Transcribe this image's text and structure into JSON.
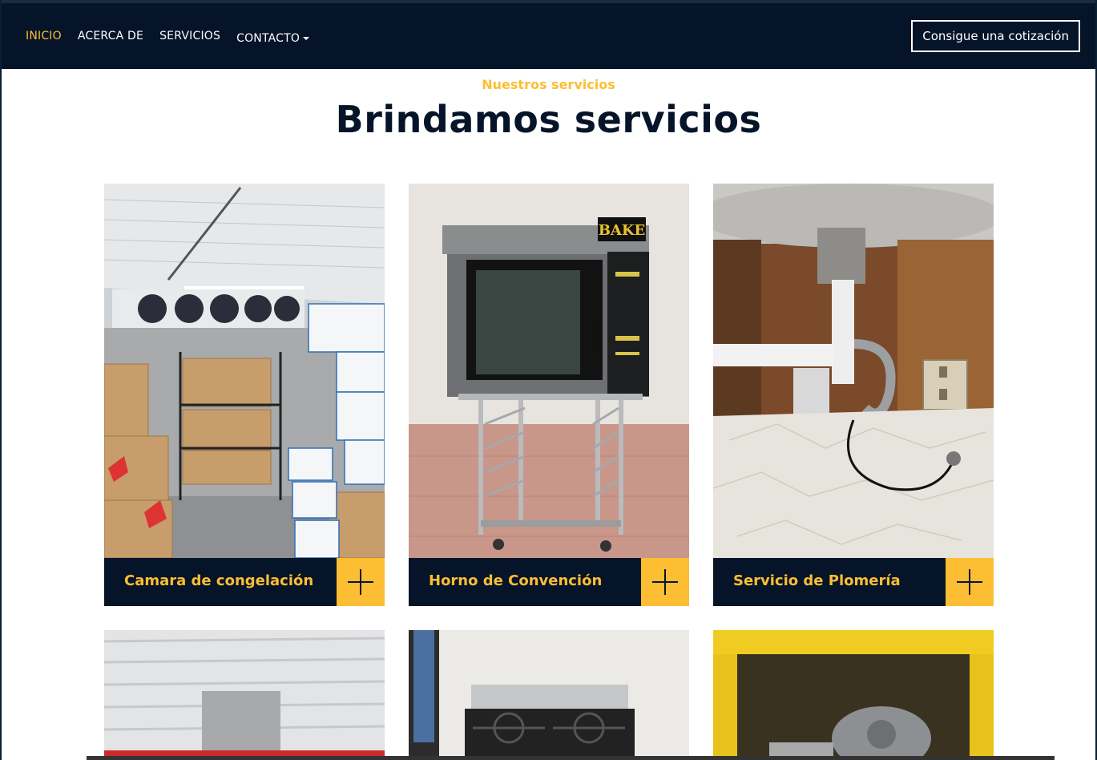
{
  "nav": {
    "links": [
      "INICIO",
      "ACERCA DE",
      "SERVICIOS",
      "CONTACTO"
    ],
    "active_index": 0,
    "quote_button": "Consigue una cotización"
  },
  "section": {
    "subtitle": "Nuestros servicios",
    "title": "Brindamos servicios"
  },
  "services": [
    {
      "label": "Camara de congelación",
      "image": "cold-storage-room-photo"
    },
    {
      "label": "Horno de Convención",
      "image": "convection-oven-photo",
      "oven_badge": "BAKE"
    },
    {
      "label": "Servicio de Plomería",
      "image": "sink-plumbing-photo"
    },
    {
      "label": "",
      "image": "refrigerated-display-photo"
    },
    {
      "label": "",
      "image": "gas-stove-photo"
    },
    {
      "label": "",
      "image": "gas-regulator-photo"
    }
  ],
  "colors": {
    "navy": "#061429",
    "accent": "#fdbe33"
  }
}
